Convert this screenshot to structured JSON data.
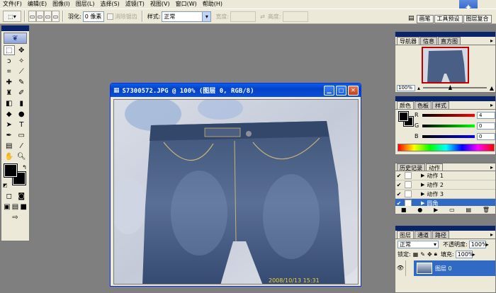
{
  "menu": [
    "文件(F)",
    "编辑(E)",
    "图像(I)",
    "图层(L)",
    "选择(S)",
    "滤镜(T)",
    "视图(V)",
    "窗口(W)",
    "帮助(H)"
  ],
  "options": {
    "feather_label": "羽化:",
    "feather_value": "0 像素",
    "antialias_label": "消除锯齿",
    "style_label": "样式:",
    "style_value": "正常",
    "width_label": "宽度:",
    "height_label": "高度:"
  },
  "palette_well": [
    "画笔",
    "工具预设",
    "图层复合"
  ],
  "document": {
    "title": "S7300572.JPG @ 100% (图层 0, RGB/8)",
    "timestamp": "2008/10/13 15:31"
  },
  "navigator": {
    "tabs": [
      "导航器",
      "信息",
      "直方图"
    ],
    "zoom": "100%"
  },
  "color": {
    "tabs": [
      "颜色",
      "色板",
      "样式"
    ],
    "r_label": "R",
    "g_label": "G",
    "b_label": "B",
    "r": "4",
    "g": "0",
    "b": "0"
  },
  "actions": {
    "tabs": [
      "历史记录",
      "动作"
    ],
    "items": [
      "动作 1",
      "动作 2",
      "动作 3",
      "圆角"
    ]
  },
  "layers": {
    "tabs": [
      "图层",
      "通道",
      "路径"
    ],
    "blend_mode": "正常",
    "opacity_label": "不透明度:",
    "opacity": "100%",
    "lock_label": "锁定:",
    "fill_label": "填充:",
    "fill": "100%",
    "layer_name": "图层 0"
  }
}
